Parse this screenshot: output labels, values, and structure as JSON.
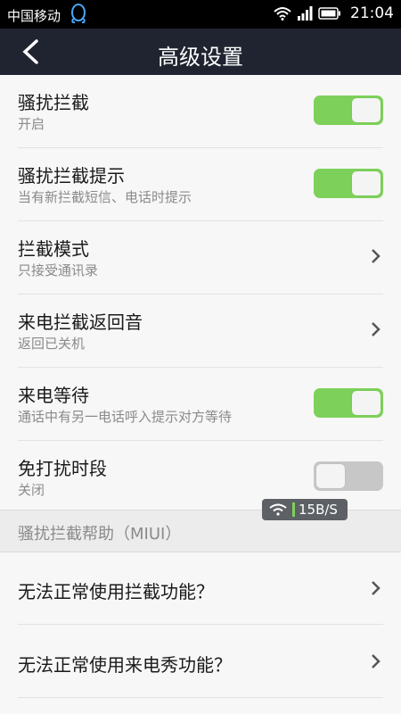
{
  "status_bar": {
    "carrier": "中国移动",
    "time": "21:04",
    "icons": [
      "qq-icon",
      "wifi-icon",
      "signal-icon",
      "battery-icon"
    ]
  },
  "header": {
    "title": "高级设置"
  },
  "settings": [
    {
      "label": "骚扰拦截",
      "sub": "开启",
      "control": "toggle",
      "on": true
    },
    {
      "label": "骚扰拦截提示",
      "sub": "当有新拦截短信、电话时提示",
      "control": "toggle",
      "on": true
    },
    {
      "label": "拦截模式",
      "sub": "只接受通讯录",
      "control": "chevron"
    },
    {
      "label": "来电拦截返回音",
      "sub": "返回已关机",
      "control": "chevron"
    },
    {
      "label": "来电等待",
      "sub": "通话中有另一电话呼入提示对方等待",
      "control": "toggle",
      "on": true
    },
    {
      "label": "免打扰时段",
      "sub": "关闭",
      "control": "toggle",
      "on": false
    }
  ],
  "section": {
    "title": "骚扰拦截帮助（MIUI）"
  },
  "help_items": [
    {
      "label": "无法正常使用拦截功能？"
    },
    {
      "label": "无法正常使用来电秀功能？"
    }
  ],
  "network_overlay": {
    "speed": "15B/S"
  },
  "colors": {
    "accent_green": "#7dd15a",
    "header_bg": "#1f2430",
    "toggle_off": "#c7c7c7"
  }
}
